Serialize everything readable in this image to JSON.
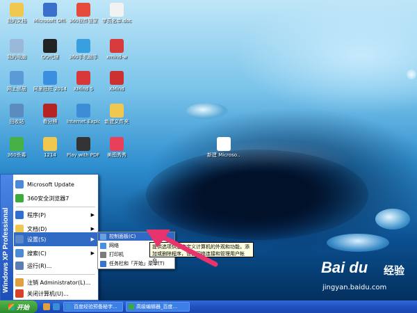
{
  "desktop": {
    "icons": [
      {
        "label": "我的文档",
        "color": "#f0c850"
      },
      {
        "label": "Microsoft Office W...",
        "color": "#3a6fc9"
      },
      {
        "label": "360软件管家",
        "color": "#e44b3c"
      },
      {
        "label": "学员名单.doc",
        "color": "#f2f2f2"
      },
      {
        "label": "我的电脑",
        "color": "#9ab8d9"
      },
      {
        "label": "QQ代理",
        "color": "#222222"
      },
      {
        "label": "360手机助手",
        "color": "#39a0e0"
      },
      {
        "label": "xmind-w",
        "color": "#d63a3a"
      },
      {
        "label": "网上邻居",
        "color": "#5a9ad6"
      },
      {
        "label": "阿里旺旺 2014",
        "color": "#3b8fe0"
      },
      {
        "label": "XMind 5",
        "color": "#d93838"
      },
      {
        "label": "XMind",
        "color": "#cc3030"
      },
      {
        "label": "回收站",
        "color": "#5c8bbd"
      },
      {
        "label": "看分辨",
        "color": "#b72222"
      },
      {
        "label": "Internet Explorer",
        "color": "#3b8ed6"
      },
      {
        "label": "新建文件夹",
        "color": "#f0c850"
      },
      {
        "label": "360杀毒",
        "color": "#46b046"
      },
      {
        "label": "1214",
        "color": "#f0c850"
      },
      {
        "label": "Play with PDF Max 2.0",
        "color": "#333333"
      },
      {
        "label": "美图秀秀",
        "color": "#e8405a"
      },
      {
        "label": "新建 Microso...",
        "color": "#ffffff"
      }
    ]
  },
  "start_menu": {
    "side_banner": "Windows XP Professional",
    "pinned": [
      {
        "label": "Microsoft Update",
        "color": "#4a8ad8"
      },
      {
        "label": "360安全浏览器7",
        "color": "#3bab3b"
      }
    ],
    "items": [
      {
        "label": "程序(P)",
        "color": "#2f6fd0"
      },
      {
        "label": "文档(D)",
        "color": "#f0c850"
      },
      {
        "label": "设置(S)",
        "color": "#5a88c8"
      },
      {
        "label": "搜索(C)",
        "color": "#4b8bd6"
      },
      {
        "label": "运行(R)...",
        "color": "#5b7eb2"
      },
      {
        "label": "注销 Administrator(L)...",
        "color": "#e0a040"
      },
      {
        "label": "关闭计算机(U)...",
        "color": "#d9402a"
      }
    ],
    "settings_submenu": [
      {
        "label": "控制面板(C)",
        "color": "#6aa2dc"
      },
      {
        "label": "网络",
        "color": "#4a90e0"
      },
      {
        "label": "打印机",
        "color": "#7a7a7a"
      },
      {
        "label": "任务栏和「开始」菜单(T)",
        "color": "#3a74c8"
      }
    ],
    "tooltip": "提供选项供您自定义计算机的外观和功能，添加或删除程序，设置网络连接和管理用户帐户。"
  },
  "taskbar": {
    "start_label": "开始",
    "tasks": [
      {
        "label": "百度经验预备秘字...",
        "color": "#3b8ed6"
      },
      {
        "label": "高级编辑器_百度...",
        "color": "#3bab3b"
      }
    ]
  },
  "watermark": {
    "logo": "Bai du",
    "word": "经验",
    "url": "jingyan.baidu.com"
  },
  "colors": {
    "accent": "#316ac5",
    "taskbar": "#2457c5",
    "start_button": "#3a9a3a",
    "arrow": "#e8336c"
  }
}
